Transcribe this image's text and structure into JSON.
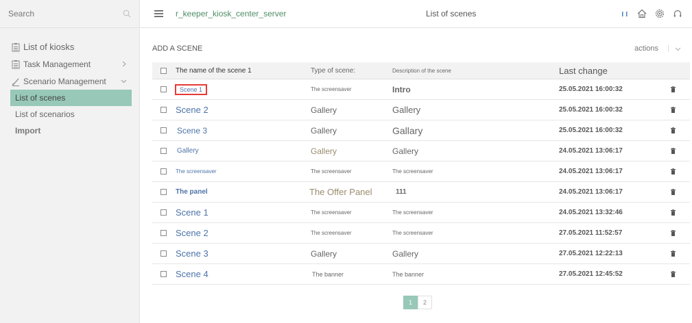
{
  "sidebar": {
    "search_placeholder": "Search",
    "items": [
      {
        "label": "List of kiosks"
      },
      {
        "label": "Task Management"
      },
      {
        "label": "Scenario Management"
      }
    ],
    "sub_items": [
      {
        "label": "List of scenes"
      },
      {
        "label": "List of scenarios"
      },
      {
        "label": "Import"
      }
    ]
  },
  "header": {
    "server_name": "r_keeper_kiosk_center_server",
    "page_title": "List of scenes"
  },
  "toolbar": {
    "add_scene_label": "ADD A SCENE",
    "actions_label": "actions"
  },
  "table": {
    "columns": {
      "name": "The name of the scene 1",
      "type": "Type of scene:",
      "description": "Description of the scene",
      "last_change": "Last change"
    },
    "rows": [
      {
        "name": "Scene 1",
        "type": "The screensaver",
        "description": "Intro",
        "last_change": "25.05.2021 16:00:32"
      },
      {
        "name": "Scene 2",
        "type": "Gallery",
        "description": "Gallery",
        "last_change": "25.05.2021 16:00:32"
      },
      {
        "name": "Scene 3",
        "type": "Gallery",
        "description": "Gallary",
        "last_change": "25.05.2021 16:00:32"
      },
      {
        "name": "Gallery",
        "type": "Gallery",
        "description": "Gallery",
        "last_change": "24.05.2021 13:06:17"
      },
      {
        "name": "The screensaver",
        "type": "The screensaver",
        "description": "The screensaver",
        "last_change": "24.05.2021 13:06:17"
      },
      {
        "name": "The panel",
        "type": "The Offer Panel",
        "description": "111",
        "last_change": "24.05.2021 13:06:17"
      },
      {
        "name": "Scene 1",
        "type": "The screensaver",
        "description": "The screensaver",
        "last_change": "24.05.2021 13:32:46"
      },
      {
        "name": "Scene 2",
        "type": "The screensaver",
        "description": "The screensaver",
        "last_change": "27.05.2021 11:52:57"
      },
      {
        "name": "Scene 3",
        "type": "Gallery",
        "description": "Gallery",
        "last_change": "27.05.2021 12:22:13"
      },
      {
        "name": "Scene 4",
        "type": "The banner",
        "description": "The banner",
        "last_change": "27.05.2021 12:45:52"
      }
    ]
  },
  "pagination": {
    "pages": [
      "1",
      "2"
    ],
    "current": "1"
  },
  "colors": {
    "accent": "#97c8b8",
    "server_name": "#4d8c63",
    "link": "#4d73a8",
    "highlight": "#e53935"
  }
}
